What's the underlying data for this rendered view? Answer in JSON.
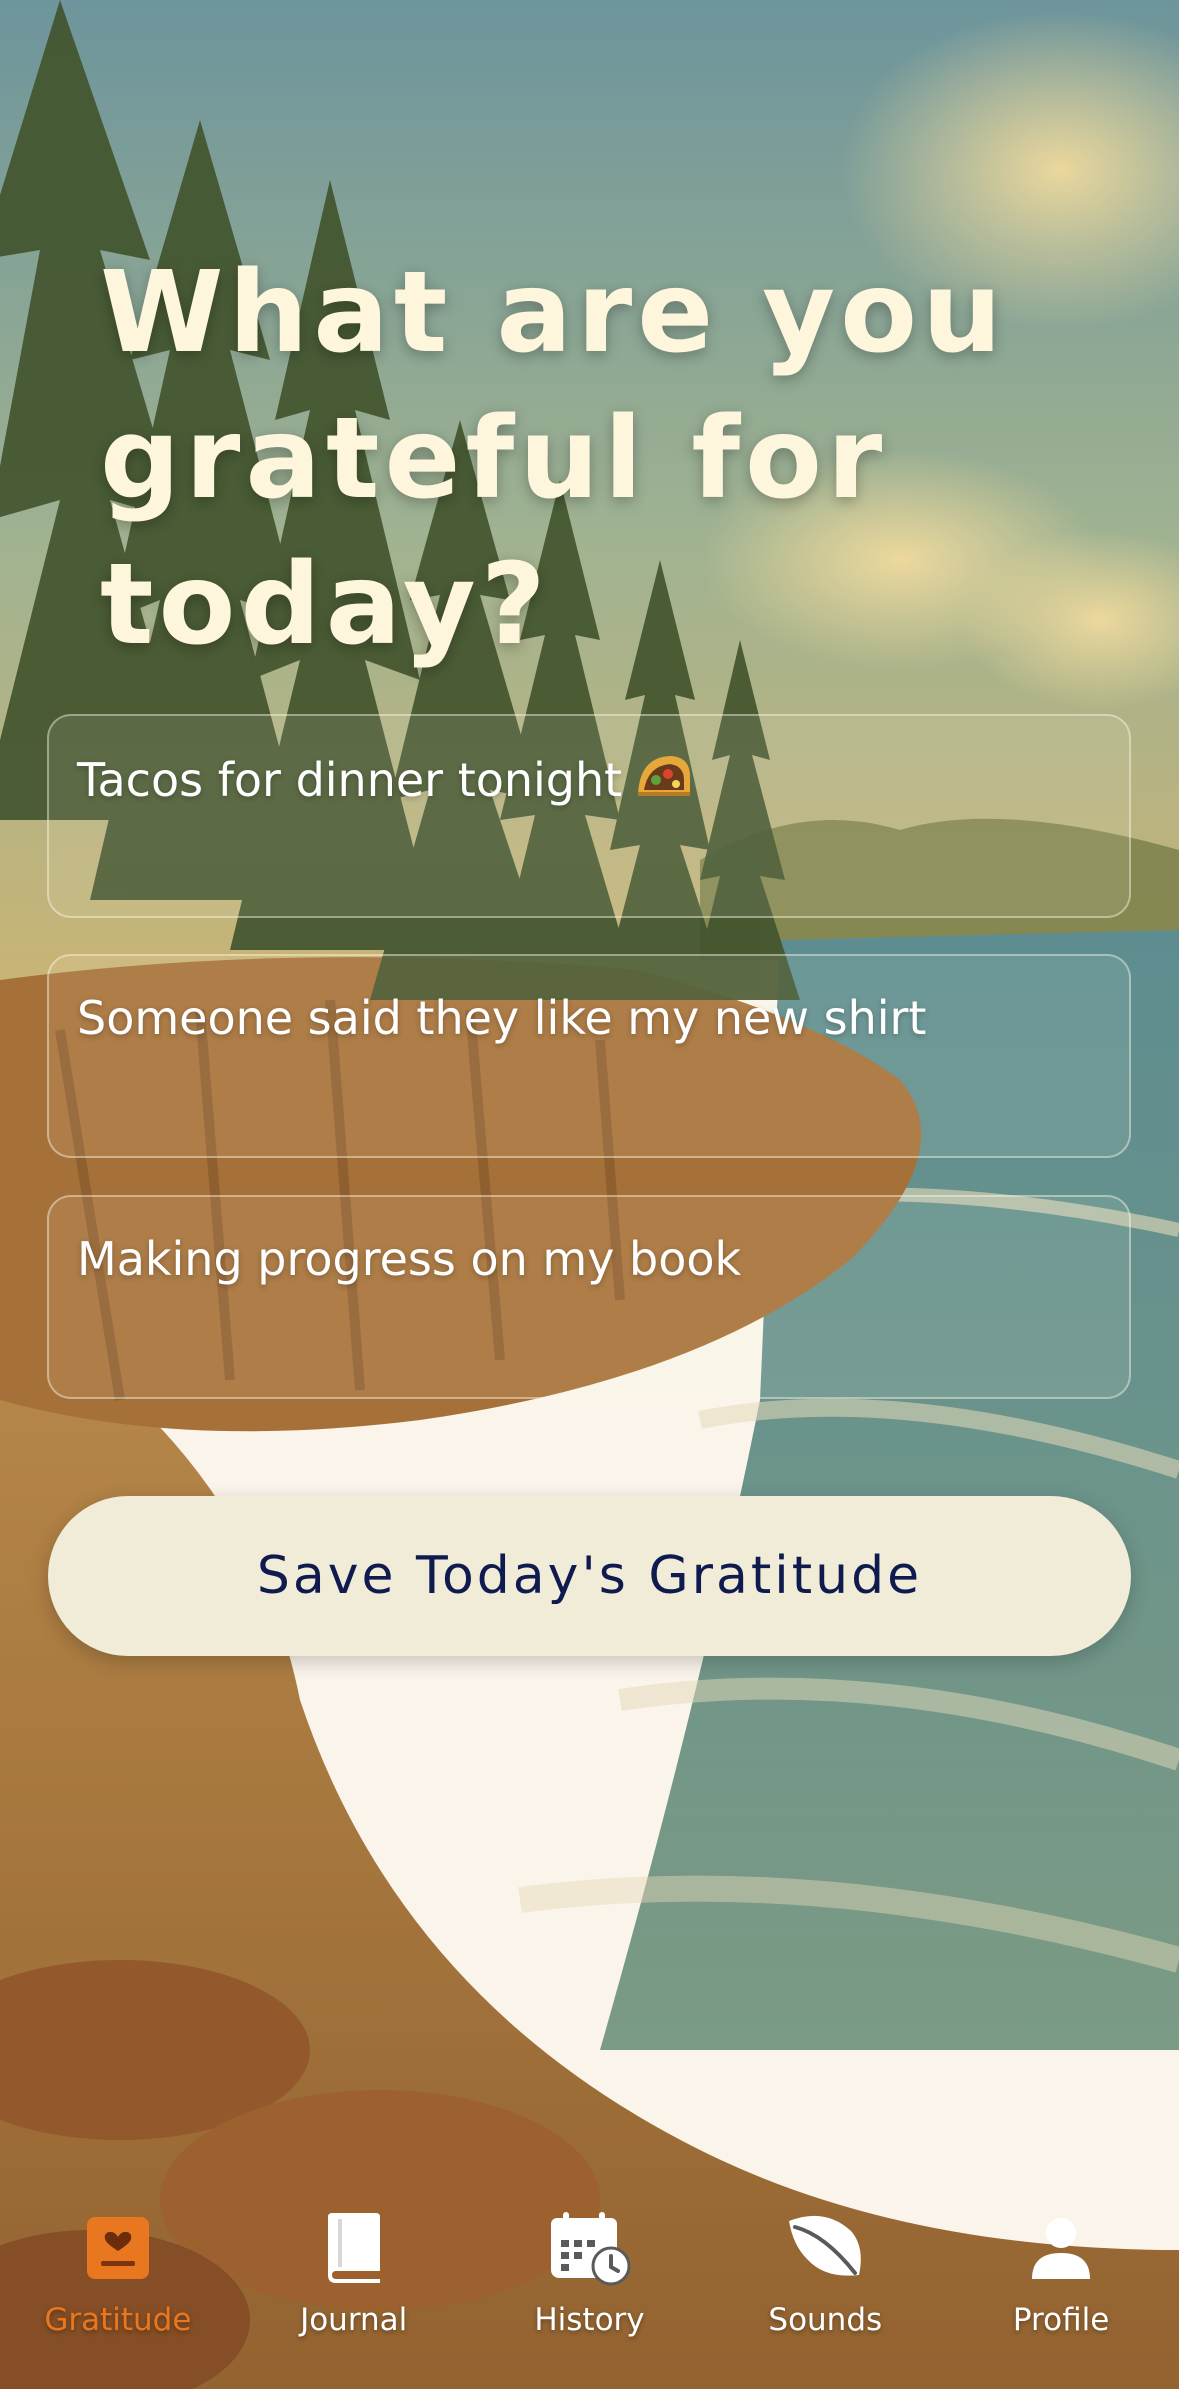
{
  "prompt": {
    "heading": "What are you grateful for today?"
  },
  "entries": [
    {
      "text": "Tacos for dinner tonight",
      "emoji_icon": "taco-icon"
    },
    {
      "text": "Someone said they like my new shirt"
    },
    {
      "text": "Making progress on my book"
    }
  ],
  "save_button": {
    "label": "Save Today's Gratitude"
  },
  "tabs": [
    {
      "label": "Gratitude",
      "icon": "heart-card-icon",
      "active": true
    },
    {
      "label": "Journal",
      "icon": "book-icon",
      "active": false
    },
    {
      "label": "History",
      "icon": "calendar-clock-icon",
      "active": false
    },
    {
      "label": "Sounds",
      "icon": "leaf-icon",
      "active": false
    },
    {
      "label": "Profile",
      "icon": "person-icon",
      "active": false
    }
  ],
  "colors": {
    "accent": "#e9771f",
    "heading_text": "#fdf6dd",
    "button_background": "#f1ecd7",
    "button_text": "#0f1b4e"
  }
}
